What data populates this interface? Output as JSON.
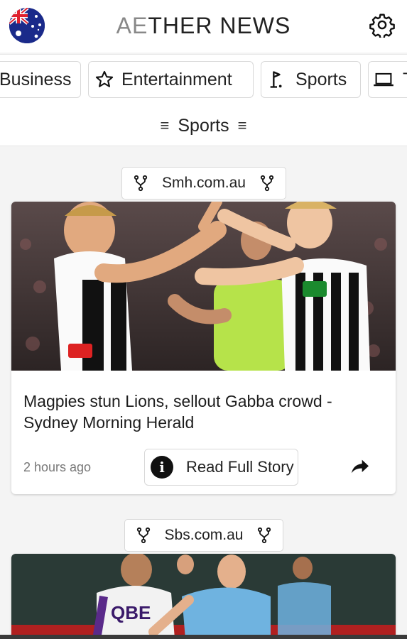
{
  "header": {
    "title_light": "AE",
    "title_dark": "THER NEWS",
    "flag": "australia-flag",
    "settings_icon": "gear-icon"
  },
  "categories": [
    {
      "label": "Business",
      "icon": "briefcase-icon"
    },
    {
      "label": "Entertainment",
      "icon": "star-icon"
    },
    {
      "label": "Sports",
      "icon": "golf-flag-icon"
    },
    {
      "label": "T",
      "icon": "laptop-icon"
    }
  ],
  "section": {
    "label": "Sports"
  },
  "articles": [
    {
      "source": "Smh.com.au",
      "headline": "Magpies stun Lions, sellout Gabba crowd - Sydney Morning Herald",
      "time": "2 hours ago",
      "read_label": "Read Full Story"
    },
    {
      "source": "Sbs.com.au",
      "image_text": "QBE"
    }
  ],
  "colors": {
    "flag_blue": "#1a2a8a",
    "flag_red": "#e0212f",
    "magpie_black": "#111111",
    "umpire_green": "#b6e34a",
    "sydney_blue": "#6fb3e0"
  }
}
